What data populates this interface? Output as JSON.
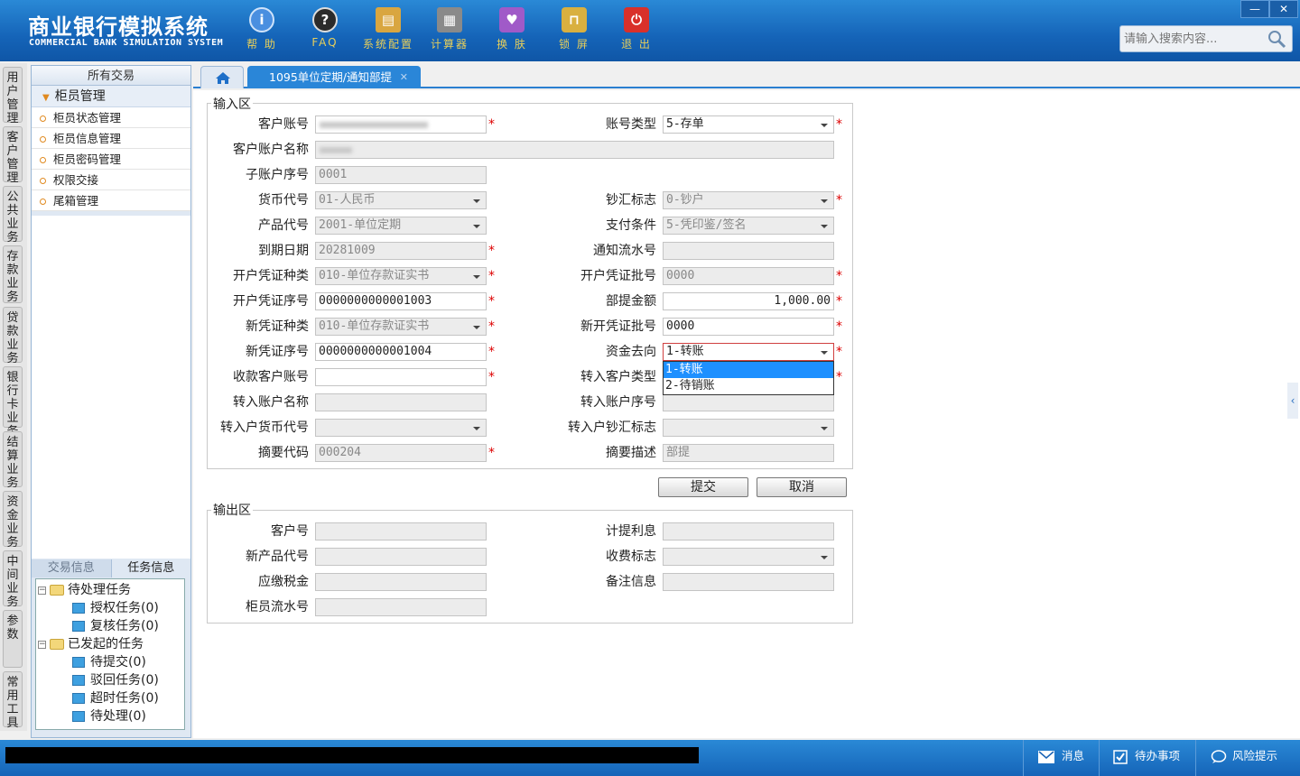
{
  "app": {
    "title_cn": "商业银行模拟系统",
    "title_en": "COMMERCIAL BANK SIMULATION SYSTEM"
  },
  "toolbar": [
    {
      "label": "帮 助",
      "icon": "info-icon",
      "color": "#4a8fe0"
    },
    {
      "label": "FAQ",
      "icon": "question-icon",
      "color": "#2b2b2b"
    },
    {
      "label": "系统配置",
      "icon": "config-icon",
      "color": "#d9a640"
    },
    {
      "label": "计算器",
      "icon": "calculator-icon",
      "color": "#8a8a8a"
    },
    {
      "label": "换 肤",
      "icon": "skin-icon",
      "color": "#a05ac8"
    },
    {
      "label": "锁 屏",
      "icon": "lock-icon",
      "color": "#d9b040"
    },
    {
      "label": "退 出",
      "icon": "power-icon",
      "color": "#d9302a"
    }
  ],
  "window": {
    "minimize": "—",
    "close": "✕"
  },
  "search": {
    "placeholder": "请输入搜索内容..."
  },
  "vtabs": [
    "用户管理",
    "客户管理",
    "公共业务",
    "存款业务",
    "贷款业务",
    "银行卡业务",
    "结算业务",
    "资金业务",
    "中间业务",
    "参数",
    "常用工具"
  ],
  "sidebar": {
    "header": "所有交易",
    "group": "柜员管理",
    "items": [
      "柜员状态管理",
      "柜员信息管理",
      "柜员密码管理",
      "权限交接",
      "尾箱管理"
    ],
    "tabs": [
      "交易信息",
      "任务信息"
    ],
    "tree": {
      "pending": "待处理任务",
      "auth": "授权任务(0)",
      "review": "复核任务(0)",
      "initiated": "已发起的任务",
      "to_submit": "待提交(0)",
      "rejected": "驳回任务(0)",
      "timeout": "超时任务(0)",
      "to_process": "待处理(0)"
    }
  },
  "tab": {
    "title": "1095单位定期/通知部提",
    "close": "✕"
  },
  "input": {
    "legend": "输入区",
    "labels": {
      "cust_acct": "客户账号",
      "acct_type": "账号类型",
      "acct_name": "客户账户名称",
      "sub_seq": "子账户序号",
      "currency": "货币代号",
      "cash_flag": "钞汇标志",
      "product": "产品代号",
      "pay_cond": "支付条件",
      "maturity": "到期日期",
      "notice_no": "通知流水号",
      "open_vtype": "开户凭证种类",
      "open_batch": "开户凭证批号",
      "open_vseq": "开户凭证序号",
      "withdraw_amt": "部提金额",
      "new_vtype": "新凭证种类",
      "new_batch": "新开凭证批号",
      "new_vseq": "新凭证序号",
      "fund_dir": "资金去向",
      "payee_acct": "收款客户账号",
      "in_cust_type": "转入客户类型",
      "in_acct_name": "转入账户名称",
      "in_acct_seq": "转入账户序号",
      "in_currency": "转入户货币代号",
      "in_cash_flag": "转入户钞汇标志",
      "abstract_code": "摘要代码",
      "abstract_desc": "摘要描述"
    },
    "values": {
      "cust_acct": "",
      "acct_type": "5-存单",
      "acct_name": "",
      "sub_seq": "0001",
      "currency": "01-人民币",
      "cash_flag": "0-钞户",
      "product": "2001-单位定期",
      "pay_cond": "5-凭印鉴/签名",
      "maturity": "20281009",
      "notice_no": "",
      "open_vtype": "010-单位存款证实书",
      "open_batch": "0000",
      "open_vseq": "0000000000001003",
      "withdraw_amt": "1,000.00",
      "new_vtype": "010-单位存款证实书",
      "new_batch": "0000",
      "new_vseq": "0000000000001004",
      "fund_dir": "1-转账",
      "payee_acct": "",
      "in_cust_type": "",
      "in_acct_name": "",
      "in_acct_seq": "",
      "in_currency": "",
      "in_cash_flag": "",
      "abstract_code": "000204",
      "abstract_desc": "部提"
    },
    "fund_dir_options": [
      "1-转账",
      "2-待销账"
    ],
    "required_mark": "*"
  },
  "actions": {
    "submit": "提交",
    "cancel": "取消"
  },
  "output": {
    "legend": "输出区",
    "labels": {
      "cust_no": "客户号",
      "accrued_interest": "计提利息",
      "new_product": "新产品代号",
      "fee_flag": "收费标志",
      "tax": "应缴税金",
      "remark": "备注信息",
      "teller_seq": "柜员流水号"
    }
  },
  "statusbar": {
    "message": "消息",
    "todo": "待办事项",
    "risk": "风险提示"
  }
}
